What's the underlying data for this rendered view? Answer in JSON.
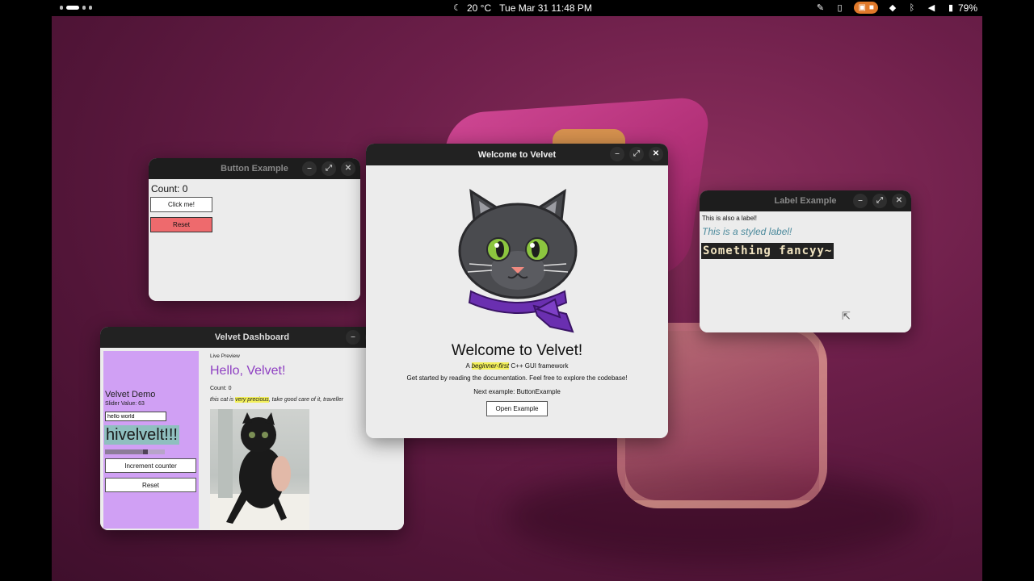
{
  "topbar": {
    "weather": "20 °C",
    "datetime": "Tue Mar 31  11:48 PM",
    "battery": "79%"
  },
  "button_example": {
    "title": "Button Example",
    "count_text": "Count: 0",
    "click_label": "Click me!",
    "reset_label": "Reset"
  },
  "welcome": {
    "title": "Welcome to Velvet",
    "heading": "Welcome to Velvet!",
    "sub_prefix": "A ",
    "sub_highlight": "beginner-first",
    "sub_suffix": " C++ GUI framework",
    "description": "Get started by reading the documentation. Feel free to explore the codebase!",
    "next_example": "Next example: ButtonExample",
    "open_label": "Open Example"
  },
  "label_example": {
    "title": "Label Example",
    "plain": "This is also a label!",
    "styled": "This is a styled label!",
    "fancy": "Something fancyy~"
  },
  "dashboard": {
    "title": "Velvet Dashboard",
    "sidebar_title": "Velvet Demo",
    "slider_value_text": "Slider Value: 63",
    "input_value": "hello world",
    "big_text": "hivelvelt!!!",
    "progress": 0.63,
    "increment_label": "Increment counter",
    "reset_label": "Reset",
    "preview_label": "Live Preview",
    "hello": "Hello, Velvet!",
    "count_text": "Count: 0",
    "cat_prefix": "this cat is ",
    "cat_highlight": "very precious",
    "cat_suffix": ", take good care of it, traveller"
  },
  "colors": {
    "accent_purple": "#8e3fc2",
    "sidebar_bg": "#d0a0f4",
    "highlight_yellow": "#f3f05a",
    "reset_red": "#ee6a6d",
    "big_text_bg": "#8fbfbf"
  }
}
